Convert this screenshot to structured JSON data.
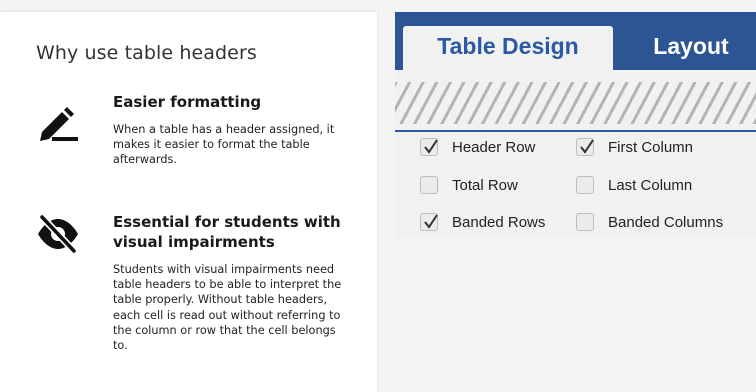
{
  "card": {
    "title": "Why use table headers",
    "features": [
      {
        "icon": "pencil-edit-icon",
        "heading": "Easier formatting",
        "body": "When a table has a header assigned, it makes it easier to format the table afterwards."
      },
      {
        "icon": "eye-slash-icon",
        "heading": "Essential for students with visual impairments",
        "body": "Students with visual impairments need table headers to be able to interpret the table properly. Without table headers, each cell is read out without referring to the column or row that the cell belongs to."
      }
    ]
  },
  "ribbon": {
    "tabs": [
      {
        "label": "Table Design",
        "active": true
      },
      {
        "label": "Layout",
        "active": false
      }
    ],
    "options": [
      {
        "label": "Header Row",
        "checked": true
      },
      {
        "label": "First Column",
        "checked": true
      },
      {
        "label": "Total Row",
        "checked": false
      },
      {
        "label": "Last Column",
        "checked": false
      },
      {
        "label": "Banded Rows",
        "checked": true
      },
      {
        "label": "Banded Columns",
        "checked": false
      }
    ],
    "colors": {
      "tabbar": "#2d5594",
      "active_tab_text": "#2a5aa1",
      "check": "#333333"
    }
  }
}
